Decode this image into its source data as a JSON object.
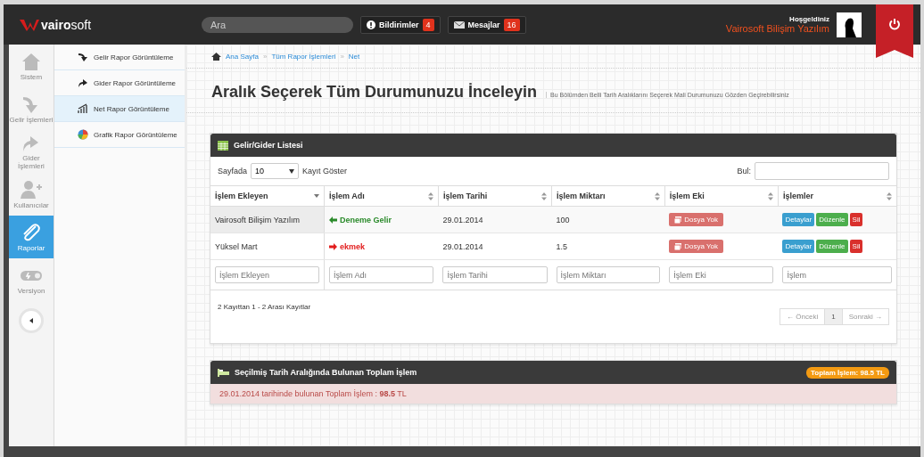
{
  "topbar": {
    "brand_bold": "vairo",
    "brand_light": "soft",
    "search": {
      "placeholder": "Ara"
    },
    "notifications": {
      "label": "Bildirimler",
      "count": "4"
    },
    "messages": {
      "label": "Mesajlar",
      "count": "16"
    },
    "welcome": "Hoşgeldiniz",
    "user": "Vairosoft Bilişim Yazılım"
  },
  "sidebar": {
    "items": [
      {
        "label": "Sistem",
        "selected": false
      },
      {
        "label": "Gelir İşlemleri",
        "selected": false
      },
      {
        "label": "Gider İşlemleri",
        "selected": false
      },
      {
        "label": "Kullanıcılar",
        "selected": false
      },
      {
        "label": "Raporlar",
        "selected": true
      },
      {
        "label": "Versiyon",
        "selected": false
      }
    ]
  },
  "submenu": {
    "items": [
      {
        "label": "Gelir Rapor Görüntüleme",
        "selected": false
      },
      {
        "label": "Gider Rapor Görüntüleme",
        "selected": false
      },
      {
        "label": "Net Rapor Görüntüleme",
        "selected": true
      },
      {
        "label": "Grafik Rapor Görüntüleme",
        "selected": false
      }
    ]
  },
  "breadcrumb": {
    "separator": "»",
    "items": [
      "Ana Sayfa",
      "Tüm Rapor İşlemleri",
      "Net"
    ]
  },
  "page_title": "Aralık Seçerek Tüm Durumunuzu İnceleyin",
  "page_subtitle": "Bu Bölümden Belli Tarih Aralıklarını Seçerek Mali Durumunuzu Gözden Geçirebilirsiniz",
  "list_panel": {
    "title": "Gelir/Gider Listesi",
    "page_size_prefix": "Sayfada",
    "page_size": "10",
    "page_size_suffix": "Kayıt Göster",
    "find_label": "Bul:",
    "columns": [
      "İşlem Ekleyen",
      "İşlem Adı",
      "İşlem Tarihi",
      "İşlem Miktarı",
      "İşlem Eki",
      "İşlemler"
    ],
    "rows": [
      {
        "user": "Vairosoft Bilişim Yazılım",
        "name": "Deneme Gelir",
        "kind": "income",
        "date": "29.01.2014",
        "amount": "100",
        "attachment": "Dosya Yok",
        "actions": [
          "Detaylar",
          "Düzenle",
          "Sil"
        ]
      },
      {
        "user": "Yüksel Mart",
        "name": "ekmek",
        "kind": "expense",
        "date": "29.01.2014",
        "amount": "1.5",
        "attachment": "Dosya Yok",
        "actions": [
          "Detaylar",
          "Düzenle",
          "Sil"
        ]
      }
    ],
    "filters": [
      {
        "placeholder": "İşlem Ekleyen"
      },
      {
        "placeholder": "İşlem Adı"
      },
      {
        "placeholder": "İşlem Tarihi"
      },
      {
        "placeholder": "İşlem Miktarı"
      },
      {
        "placeholder": "İşlem Eki"
      },
      {
        "placeholder": "İşlem"
      }
    ],
    "info": "2 Kayıttan 1 - 2 Arası Kayıtlar",
    "pagination": [
      {
        "label": "← Önceki",
        "selected": false
      },
      {
        "label": "1",
        "selected": true
      },
      {
        "label": "Sonraki →",
        "selected": false
      }
    ]
  },
  "summary_panel": {
    "title": "Seçilmiş Tarih Aralığında Bulunan Toplam İşlem",
    "badge": "Toplam İşlem: 98.5 TL",
    "message": "29.01.2014 tarihinde bulunan Toplam İşlem : **98.5** TL"
  }
}
